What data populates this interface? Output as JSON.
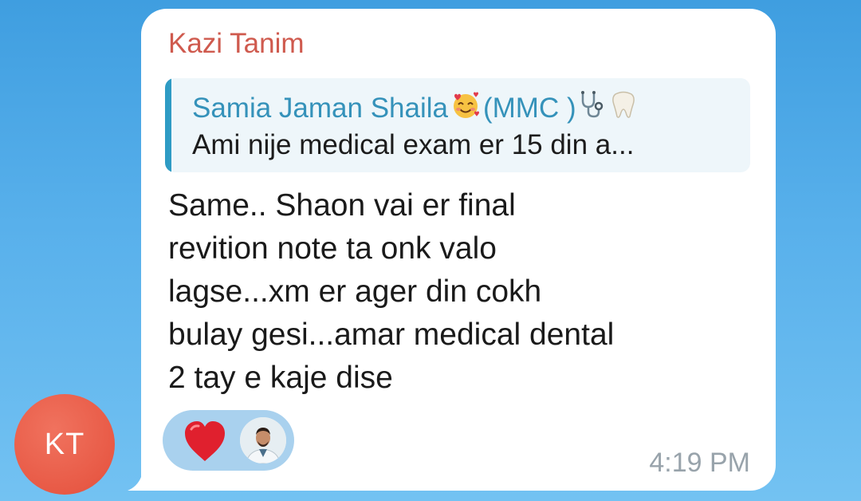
{
  "message": {
    "sender": "Kazi Tanim",
    "reply": {
      "name": "Samia Jaman Shaila",
      "name_suffix": "(MMC )",
      "text": "Ami nije medical exam er  15 din a..."
    },
    "body": "Same.. Shaon vai er final\nrevition note ta onk valo\nlagse...xm er ager din cokh\nbulay gesi...amar medical dental\n2 tay e kaje dise",
    "reactions": [
      {
        "icon": "red-heart-icon",
        "count_shown_as": "avatar"
      }
    ],
    "time": "4:19 PM"
  },
  "avatar": {
    "initials": "KT",
    "color": "#e85a46"
  },
  "colors": {
    "sender_name": "#cf5a4e",
    "reply_accent": "#2e9bc4",
    "reaction_pill": "#a9d1ee",
    "background_top": "#3f9ee0"
  }
}
